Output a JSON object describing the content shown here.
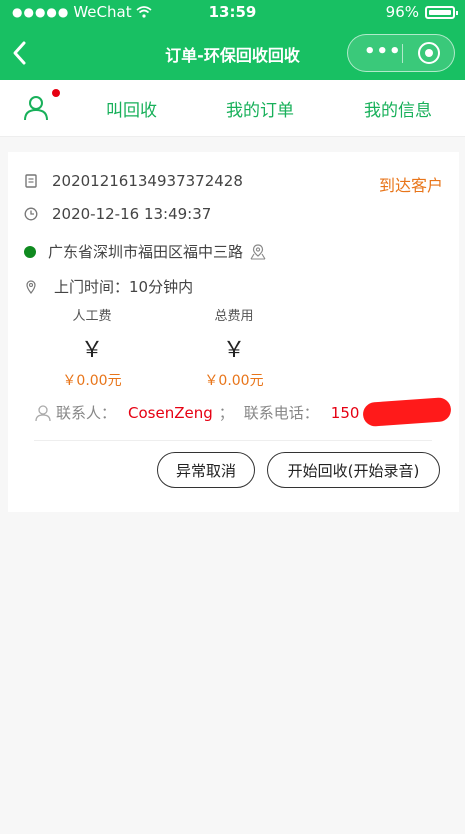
{
  "status_bar": {
    "signal": "●●●●●",
    "carrier": "WeChat",
    "time": "13:59",
    "battery_pct": "96%"
  },
  "nav": {
    "title": "订单-环保回收回收",
    "more": "•••"
  },
  "tabs": {
    "items": [
      "叫回收",
      "我的订单",
      "我的信息"
    ]
  },
  "order": {
    "id": "20201216134937372428",
    "status": "到达客户",
    "datetime": "2020-12-16 13:49:37",
    "address": "广东省深圳市福田区福中三路",
    "visit_time": "上门时间：10分钟内",
    "fees": [
      {
        "label": "人工费",
        "symbol": "￥",
        "amount": "￥0.00元"
      },
      {
        "label": "总费用",
        "symbol": "￥",
        "amount": "￥0.00元"
      }
    ],
    "contact_label": "联系人：",
    "contact_name": "CosenZeng",
    "semicolon": "；",
    "phone_label": "联系电话：",
    "phone_visible": "150",
    "buttons": {
      "cancel": "异常取消",
      "start": "开始回收(开始录音)"
    }
  },
  "colors": {
    "brand_green": "#18c063",
    "accent_orange": "#e8751a",
    "alert_red": "#e60012"
  }
}
